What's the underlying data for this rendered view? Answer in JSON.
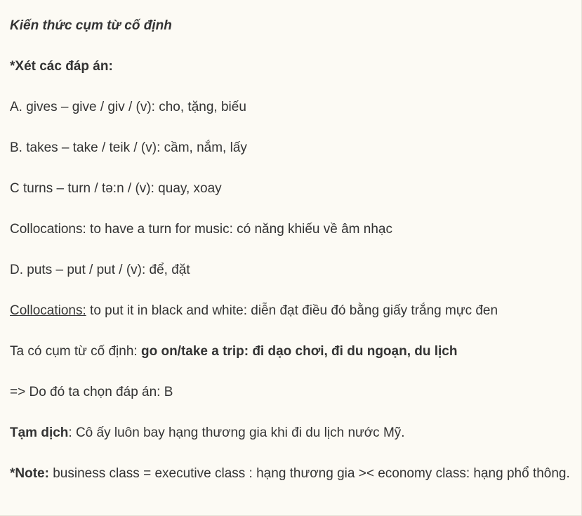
{
  "title": "Kiến thức cụm từ cố định",
  "heading": "*Xét các đáp án:",
  "options": {
    "a": "A. gives – give / giv / (v): cho, tặng, biếu",
    "b": "B. takes – take / teik / (v): cầm, nắm, lấy",
    "c": "C turns – turn / tə:n / (v): quay, xoay",
    "c_collocation": "Collocations: to have a turn for music: có năng khiếu về âm nhạc",
    "d": "D. puts – put / put / (v): để, đặt",
    "d_collocation_label": "Collocations:",
    "d_collocation_text": " to put it in black and white: diễn đạt điều đó bằng giấy trắng mực đen"
  },
  "fixed_phrase": {
    "prefix": "Ta có cụm từ cố định: ",
    "phrase": "go on/take a trip: đi dạo chơi, đi du ngoạn, du lịch"
  },
  "conclusion": "=> Do đó ta chọn đáp án: B",
  "translation": {
    "label": "Tạm dịch",
    "text": ": Cô ấy luôn bay hạng thương gia khi đi du lịch nước Mỹ."
  },
  "note": {
    "label": "*Note:",
    "text": " business class = executive class : hạng thương gia >< economy class: hạng phổ thông."
  }
}
